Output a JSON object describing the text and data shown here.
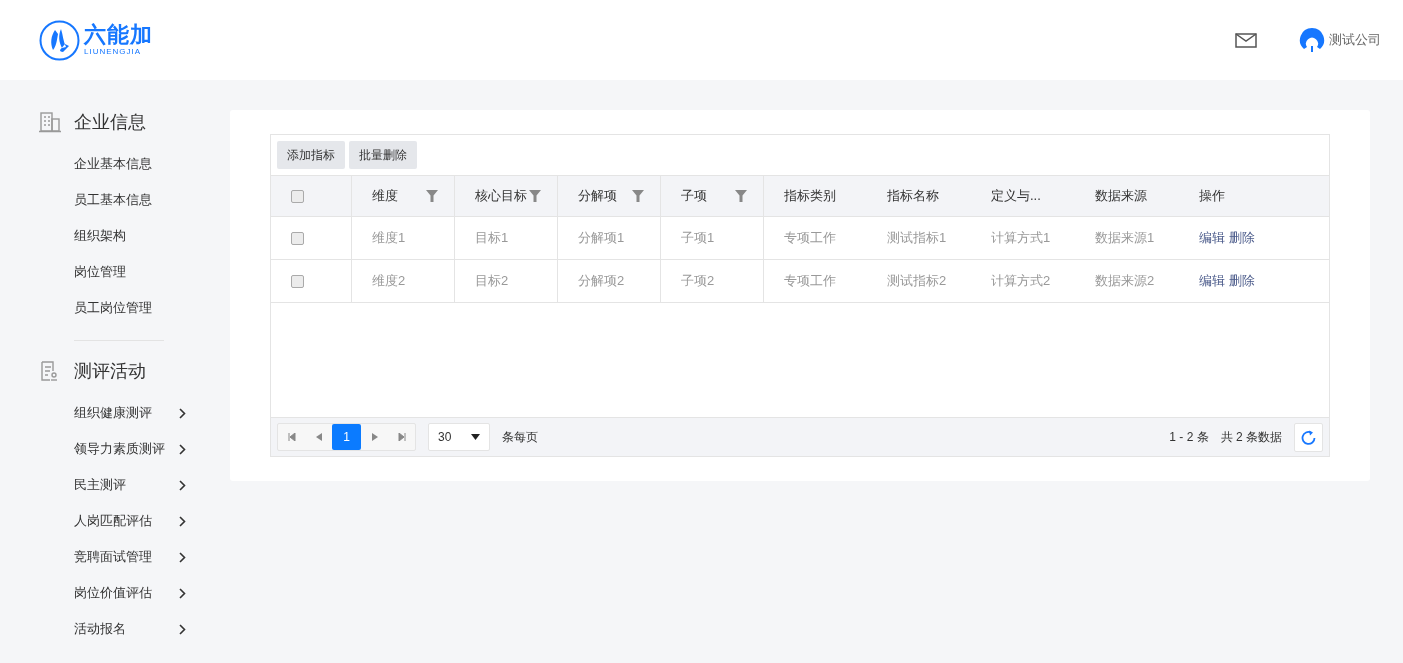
{
  "header": {
    "logo": {
      "name": "六能加",
      "subtitle": "LIUNENGJIA"
    },
    "user": "测试公司"
  },
  "sidebar": {
    "sections": [
      {
        "kind": "building",
        "title": "企业信息",
        "items": [
          {
            "label": "企业基本信息",
            "has_children": false
          },
          {
            "label": "员工基本信息",
            "has_children": false
          },
          {
            "label": "组织架构",
            "has_children": false
          },
          {
            "label": "岗位管理",
            "has_children": false
          },
          {
            "label": "员工岗位管理",
            "has_children": false
          }
        ]
      },
      {
        "kind": "document",
        "title": "测评活动",
        "items": [
          {
            "label": "组织健康测评",
            "has_children": true
          },
          {
            "label": "领导力素质测评",
            "has_children": true
          },
          {
            "label": "民主测评",
            "has_children": true
          },
          {
            "label": "人岗匹配评估",
            "has_children": true
          },
          {
            "label": "竞聘面试管理",
            "has_children": true
          },
          {
            "label": "岗位价值评估",
            "has_children": true
          },
          {
            "label": "活动报名",
            "has_children": true
          }
        ]
      }
    ]
  },
  "toolbar": {
    "buttons": [
      "添加指标",
      "批量删除"
    ]
  },
  "table": {
    "header_checked": false,
    "columns": [
      {
        "label": "维度",
        "filterable": true
      },
      {
        "label": "核心目标",
        "filterable": true
      },
      {
        "label": "分解项",
        "filterable": true
      },
      {
        "label": "子项",
        "filterable": true
      },
      {
        "label": "指标类别",
        "filterable": false
      },
      {
        "label": "指标名称",
        "filterable": false
      },
      {
        "label": "定义与...",
        "filterable": false
      },
      {
        "label": "数据来源",
        "filterable": false
      },
      {
        "label": "操作",
        "filterable": false
      }
    ],
    "rows": [
      {
        "checked": false,
        "cells": [
          "维度1",
          "目标1",
          "分解项1",
          "子项1",
          "专项工作",
          "测试指标1",
          "计算方式1",
          "数据来源1"
        ],
        "actions": [
          "编辑",
          "删除"
        ]
      },
      {
        "checked": false,
        "cells": [
          "维度2",
          "目标2",
          "分解项2",
          "子项2",
          "专项工作",
          "测试指标2",
          "计算方式2",
          "数据来源2"
        ],
        "actions": [
          "编辑",
          "删除"
        ]
      }
    ]
  },
  "pagination": {
    "pages": [
      {
        "label": "1",
        "selected": true
      }
    ],
    "page_size": "30",
    "page_size_label": "条每页",
    "range": "1 - 2 条",
    "total": "共 2 条数据"
  }
}
